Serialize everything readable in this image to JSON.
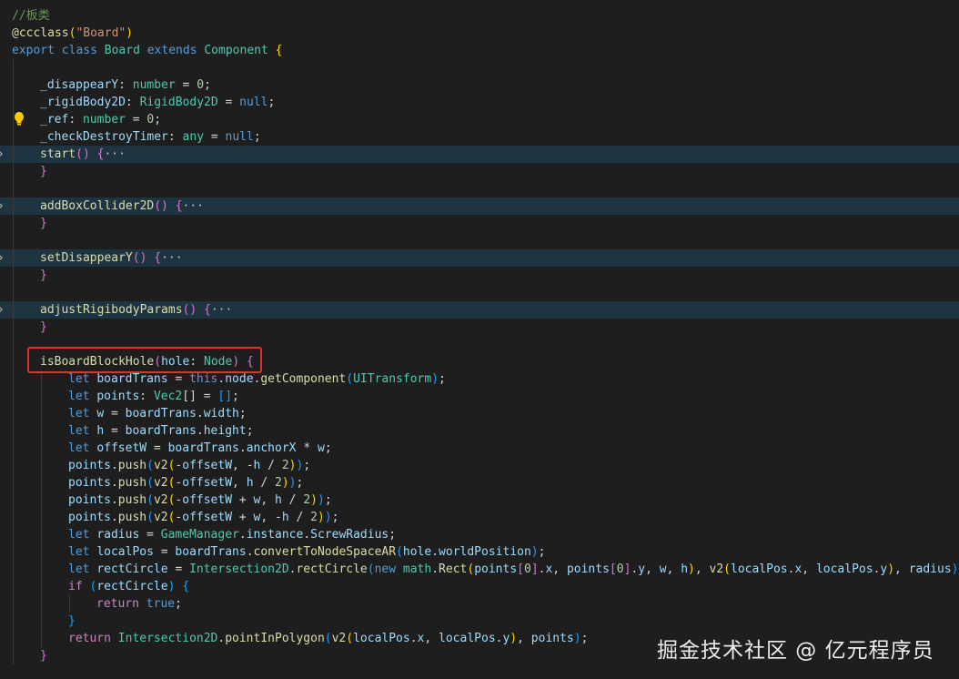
{
  "editor": {
    "line_height": 19,
    "lines": [
      {
        "indent": 0,
        "tokens": [
          [
            "//板类",
            "comment"
          ]
        ]
      },
      {
        "indent": 0,
        "tokens": [
          [
            "@ccclass",
            "dec"
          ],
          [
            "(",
            "b1"
          ],
          [
            "\"Board\"",
            "str"
          ],
          [
            ")",
            "b1"
          ]
        ]
      },
      {
        "indent": 0,
        "tokens": [
          [
            "export ",
            "kw"
          ],
          [
            "class ",
            "kw"
          ],
          [
            "Board ",
            "type"
          ],
          [
            "extends ",
            "kw"
          ],
          [
            "Component ",
            "type"
          ],
          [
            "{",
            "b1"
          ]
        ]
      },
      {
        "indent": 0,
        "tokens": []
      },
      {
        "indent": 1,
        "tokens": [
          [
            "_disappearY",
            "var"
          ],
          [
            ": ",
            "plain"
          ],
          [
            "number",
            "type"
          ],
          [
            " = ",
            "plain"
          ],
          [
            "0",
            "num"
          ],
          [
            ";",
            "plain"
          ]
        ]
      },
      {
        "indent": 1,
        "tokens": [
          [
            "_rigidBody2D",
            "var"
          ],
          [
            ": ",
            "plain"
          ],
          [
            "RigidBody2D",
            "type"
          ],
          [
            " = ",
            "plain"
          ],
          [
            "null",
            "kw"
          ],
          [
            ";",
            "plain"
          ]
        ]
      },
      {
        "indent": 1,
        "tokens": [
          [
            "_ref",
            "var"
          ],
          [
            ": ",
            "plain"
          ],
          [
            "number",
            "type"
          ],
          [
            " = ",
            "plain"
          ],
          [
            "0",
            "num"
          ],
          [
            ";",
            "plain"
          ]
        ]
      },
      {
        "indent": 1,
        "tokens": [
          [
            "_checkDestroyTimer",
            "var"
          ],
          [
            ": ",
            "plain"
          ],
          [
            "any",
            "type"
          ],
          [
            " = ",
            "plain"
          ],
          [
            "null",
            "kw"
          ],
          [
            ";",
            "plain"
          ]
        ]
      },
      {
        "indent": 1,
        "folded": true,
        "tokens": [
          [
            "start",
            "fn"
          ],
          [
            "() ",
            "b2"
          ],
          [
            "{",
            "b2"
          ],
          [
            "···",
            "ellipsis"
          ]
        ]
      },
      {
        "indent": 1,
        "tokens": [
          [
            "}",
            "b2"
          ]
        ]
      },
      {
        "indent": 0,
        "tokens": []
      },
      {
        "indent": 1,
        "folded": true,
        "tokens": [
          [
            "addBoxCollider2D",
            "fn"
          ],
          [
            "() ",
            "b2"
          ],
          [
            "{",
            "b2"
          ],
          [
            "···",
            "ellipsis"
          ]
        ]
      },
      {
        "indent": 1,
        "tokens": [
          [
            "}",
            "b2"
          ]
        ]
      },
      {
        "indent": 0,
        "tokens": []
      },
      {
        "indent": 1,
        "folded": true,
        "tokens": [
          [
            "setDisappearY",
            "fn"
          ],
          [
            "() ",
            "b2"
          ],
          [
            "{",
            "b2"
          ],
          [
            "···",
            "ellipsis"
          ]
        ]
      },
      {
        "indent": 1,
        "tokens": [
          [
            "}",
            "b2"
          ]
        ]
      },
      {
        "indent": 0,
        "tokens": []
      },
      {
        "indent": 1,
        "folded": true,
        "tokens": [
          [
            "adjustRigibodyParams",
            "fn"
          ],
          [
            "() ",
            "b2"
          ],
          [
            "{",
            "b2"
          ],
          [
            "···",
            "ellipsis"
          ]
        ]
      },
      {
        "indent": 1,
        "tokens": [
          [
            "}",
            "b2"
          ]
        ]
      },
      {
        "indent": 0,
        "tokens": []
      },
      {
        "indent": 1,
        "tokens": [
          [
            "isBoardBlockHole",
            "fn"
          ],
          [
            "(",
            "b2"
          ],
          [
            "hole",
            "var"
          ],
          [
            ": ",
            "plain"
          ],
          [
            "Node",
            "type"
          ],
          [
            ")",
            "b2"
          ],
          [
            " ",
            "plain"
          ],
          [
            "{",
            "b2"
          ]
        ]
      },
      {
        "indent": 2,
        "tokens": [
          [
            "let ",
            "kw"
          ],
          [
            "boardTrans",
            "var"
          ],
          [
            " = ",
            "plain"
          ],
          [
            "this",
            "kw"
          ],
          [
            ".",
            "plain"
          ],
          [
            "node",
            "var"
          ],
          [
            ".",
            "plain"
          ],
          [
            "getComponent",
            "fn"
          ],
          [
            "(",
            "b3"
          ],
          [
            "UITransform",
            "type"
          ],
          [
            ")",
            "b3"
          ],
          [
            ";",
            "plain"
          ]
        ]
      },
      {
        "indent": 2,
        "tokens": [
          [
            "let ",
            "kw"
          ],
          [
            "points",
            "var"
          ],
          [
            ": ",
            "plain"
          ],
          [
            "Vec2",
            "type"
          ],
          [
            "[] = ",
            "plain"
          ],
          [
            "[]",
            "b3"
          ],
          [
            ";",
            "plain"
          ]
        ]
      },
      {
        "indent": 2,
        "tokens": [
          [
            "let ",
            "kw"
          ],
          [
            "w",
            "var"
          ],
          [
            " = ",
            "plain"
          ],
          [
            "boardTrans",
            "var"
          ],
          [
            ".",
            "plain"
          ],
          [
            "width",
            "var"
          ],
          [
            ";",
            "plain"
          ]
        ]
      },
      {
        "indent": 2,
        "tokens": [
          [
            "let ",
            "kw"
          ],
          [
            "h",
            "var"
          ],
          [
            " = ",
            "plain"
          ],
          [
            "boardTrans",
            "var"
          ],
          [
            ".",
            "plain"
          ],
          [
            "height",
            "var"
          ],
          [
            ";",
            "plain"
          ]
        ]
      },
      {
        "indent": 2,
        "tokens": [
          [
            "let ",
            "kw"
          ],
          [
            "offsetW",
            "var"
          ],
          [
            " = ",
            "plain"
          ],
          [
            "boardTrans",
            "var"
          ],
          [
            ".",
            "plain"
          ],
          [
            "anchorX",
            "var"
          ],
          [
            " * ",
            "plain"
          ],
          [
            "w",
            "var"
          ],
          [
            ";",
            "plain"
          ]
        ]
      },
      {
        "indent": 2,
        "tokens": [
          [
            "points",
            "var"
          ],
          [
            ".",
            "plain"
          ],
          [
            "push",
            "fn"
          ],
          [
            "(",
            "b3"
          ],
          [
            "v2",
            "fn"
          ],
          [
            "(",
            "b1"
          ],
          [
            "-",
            "plain"
          ],
          [
            "offsetW",
            "var"
          ],
          [
            ", -",
            "plain"
          ],
          [
            "h",
            "var"
          ],
          [
            " / ",
            "plain"
          ],
          [
            "2",
            "num"
          ],
          [
            ")",
            "b1"
          ],
          [
            ")",
            "b3"
          ],
          [
            ";",
            "plain"
          ]
        ]
      },
      {
        "indent": 2,
        "tokens": [
          [
            "points",
            "var"
          ],
          [
            ".",
            "plain"
          ],
          [
            "push",
            "fn"
          ],
          [
            "(",
            "b3"
          ],
          [
            "v2",
            "fn"
          ],
          [
            "(",
            "b1"
          ],
          [
            "-",
            "plain"
          ],
          [
            "offsetW",
            "var"
          ],
          [
            ", ",
            "plain"
          ],
          [
            "h",
            "var"
          ],
          [
            " / ",
            "plain"
          ],
          [
            "2",
            "num"
          ],
          [
            ")",
            "b1"
          ],
          [
            ")",
            "b3"
          ],
          [
            ";",
            "plain"
          ]
        ]
      },
      {
        "indent": 2,
        "tokens": [
          [
            "points",
            "var"
          ],
          [
            ".",
            "plain"
          ],
          [
            "push",
            "fn"
          ],
          [
            "(",
            "b3"
          ],
          [
            "v2",
            "fn"
          ],
          [
            "(",
            "b1"
          ],
          [
            "-",
            "plain"
          ],
          [
            "offsetW",
            "var"
          ],
          [
            " + ",
            "plain"
          ],
          [
            "w",
            "var"
          ],
          [
            ", ",
            "plain"
          ],
          [
            "h",
            "var"
          ],
          [
            " / ",
            "plain"
          ],
          [
            "2",
            "num"
          ],
          [
            ")",
            "b1"
          ],
          [
            ")",
            "b3"
          ],
          [
            ";",
            "plain"
          ]
        ]
      },
      {
        "indent": 2,
        "tokens": [
          [
            "points",
            "var"
          ],
          [
            ".",
            "plain"
          ],
          [
            "push",
            "fn"
          ],
          [
            "(",
            "b3"
          ],
          [
            "v2",
            "fn"
          ],
          [
            "(",
            "b1"
          ],
          [
            "-",
            "plain"
          ],
          [
            "offsetW",
            "var"
          ],
          [
            " + ",
            "plain"
          ],
          [
            "w",
            "var"
          ],
          [
            ", -",
            "plain"
          ],
          [
            "h",
            "var"
          ],
          [
            " / ",
            "plain"
          ],
          [
            "2",
            "num"
          ],
          [
            ")",
            "b1"
          ],
          [
            ")",
            "b3"
          ],
          [
            ";",
            "plain"
          ]
        ]
      },
      {
        "indent": 2,
        "tokens": [
          [
            "let ",
            "kw"
          ],
          [
            "radius",
            "var"
          ],
          [
            " = ",
            "plain"
          ],
          [
            "GameManager",
            "type"
          ],
          [
            ".",
            "plain"
          ],
          [
            "instance",
            "var"
          ],
          [
            ".",
            "plain"
          ],
          [
            "ScrewRadius",
            "var"
          ],
          [
            ";",
            "plain"
          ]
        ]
      },
      {
        "indent": 2,
        "tokens": [
          [
            "let ",
            "kw"
          ],
          [
            "localPos",
            "var"
          ],
          [
            " = ",
            "plain"
          ],
          [
            "boardTrans",
            "var"
          ],
          [
            ".",
            "plain"
          ],
          [
            "convertToNodeSpaceAR",
            "fn"
          ],
          [
            "(",
            "b3"
          ],
          [
            "hole",
            "var"
          ],
          [
            ".",
            "plain"
          ],
          [
            "worldPosition",
            "var"
          ],
          [
            ")",
            "b3"
          ],
          [
            ";",
            "plain"
          ]
        ]
      },
      {
        "indent": 2,
        "tokens": [
          [
            "let ",
            "kw"
          ],
          [
            "rectCircle",
            "var"
          ],
          [
            " = ",
            "plain"
          ],
          [
            "Intersection2D",
            "type"
          ],
          [
            ".",
            "plain"
          ],
          [
            "rectCircle",
            "fn"
          ],
          [
            "(",
            "b3"
          ],
          [
            "new ",
            "kw"
          ],
          [
            "math",
            "type"
          ],
          [
            ".",
            "plain"
          ],
          [
            "Rect",
            "fn"
          ],
          [
            "(",
            "b1"
          ],
          [
            "points",
            "var"
          ],
          [
            "[",
            "b2"
          ],
          [
            "0",
            "num"
          ],
          [
            "]",
            "b2"
          ],
          [
            ".",
            "plain"
          ],
          [
            "x",
            "var"
          ],
          [
            ", ",
            "plain"
          ],
          [
            "points",
            "var"
          ],
          [
            "[",
            "b2"
          ],
          [
            "0",
            "num"
          ],
          [
            "]",
            "b2"
          ],
          [
            ".",
            "plain"
          ],
          [
            "y",
            "var"
          ],
          [
            ", ",
            "plain"
          ],
          [
            "w",
            "var"
          ],
          [
            ", ",
            "plain"
          ],
          [
            "h",
            "var"
          ],
          [
            ")",
            "b1"
          ],
          [
            ", ",
            "plain"
          ],
          [
            "v2",
            "fn"
          ],
          [
            "(",
            "b1"
          ],
          [
            "localPos",
            "var"
          ],
          [
            ".",
            "plain"
          ],
          [
            "x",
            "var"
          ],
          [
            ", ",
            "plain"
          ],
          [
            "localPos",
            "var"
          ],
          [
            ".",
            "plain"
          ],
          [
            "y",
            "var"
          ],
          [
            ")",
            "b1"
          ],
          [
            ", ",
            "plain"
          ],
          [
            "radius",
            "var"
          ],
          [
            ")",
            "b3"
          ],
          [
            ";",
            "plain"
          ]
        ]
      },
      {
        "indent": 2,
        "tokens": [
          [
            "if ",
            "ctrl"
          ],
          [
            "(",
            "b3"
          ],
          [
            "rectCircle",
            "var"
          ],
          [
            ")",
            "b3"
          ],
          [
            " ",
            "plain"
          ],
          [
            "{",
            "b3"
          ]
        ]
      },
      {
        "indent": 3,
        "tokens": [
          [
            "return ",
            "ctrl"
          ],
          [
            "true",
            "kw"
          ],
          [
            ";",
            "plain"
          ]
        ]
      },
      {
        "indent": 2,
        "tokens": [
          [
            "}",
            "b3"
          ]
        ]
      },
      {
        "indent": 2,
        "tokens": [
          [
            "return ",
            "ctrl"
          ],
          [
            "Intersection2D",
            "type"
          ],
          [
            ".",
            "plain"
          ],
          [
            "pointInPolygon",
            "fn"
          ],
          [
            "(",
            "b3"
          ],
          [
            "v2",
            "fn"
          ],
          [
            "(",
            "b1"
          ],
          [
            "localPos",
            "var"
          ],
          [
            ".",
            "plain"
          ],
          [
            "x",
            "var"
          ],
          [
            ", ",
            "plain"
          ],
          [
            "localPos",
            "var"
          ],
          [
            ".",
            "plain"
          ],
          [
            "y",
            "var"
          ],
          [
            ")",
            "b1"
          ],
          [
            ", ",
            "plain"
          ],
          [
            "points",
            "var"
          ],
          [
            ")",
            "b3"
          ],
          [
            ";",
            "plain"
          ]
        ]
      },
      {
        "indent": 1,
        "tokens": [
          [
            "}",
            "b2"
          ]
        ]
      }
    ]
  },
  "colors": {
    "background": "#1e1e1e",
    "folded_line": "#1f3441",
    "highlight_box": "#e0332e",
    "lightbulb": "#ffcc00"
  },
  "lightbulb_icon": "lightbulb-icon",
  "fold_icon": "chevron-right-icon",
  "watermark": "掘金技术社区 @ 亿元程序员"
}
